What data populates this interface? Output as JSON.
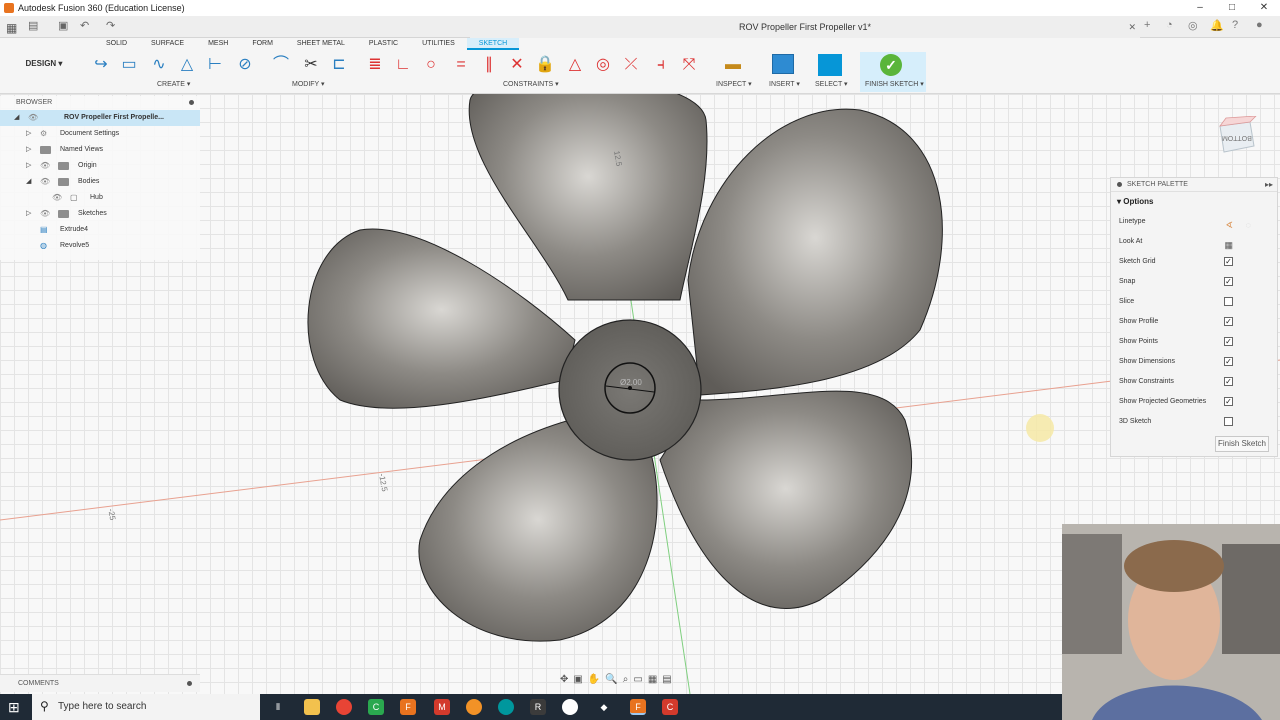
{
  "window": {
    "title": "Autodesk Fusion 360 (Education License)",
    "minimize": "–",
    "maximize": "□",
    "close": "✕"
  },
  "document_tab": {
    "title": "ROV Propeller First Propeller v1*",
    "close": "✕"
  },
  "design_menu": {
    "label": "DESIGN ▾"
  },
  "workspace_tabs": [
    "SOLID",
    "SURFACE",
    "MESH",
    "FORM",
    "SHEET METAL",
    "PLASTIC",
    "UTILITIES",
    "SKETCH"
  ],
  "active_workspace": "SKETCH",
  "toolbar_groups": {
    "create": "CREATE ▾",
    "modify": "MODIFY ▾",
    "constraints": "CONSTRAINTS ▾",
    "inspect": "INSPECT ▾",
    "insert": "INSERT ▾",
    "select": "SELECT ▾",
    "finish_sketch": "FINISH SKETCH ▾"
  },
  "browser": {
    "header": "BROWSER",
    "root": "ROV Propeller First Propelle...",
    "items": [
      {
        "label": "Document Settings",
        "icon": "gear-icon"
      },
      {
        "label": "Named Views",
        "icon": "folder-icon"
      },
      {
        "label": "Origin",
        "icon": "folder-icon"
      },
      {
        "label": "Bodies",
        "icon": "folder-icon"
      },
      {
        "label": "Hub",
        "icon": "body-icon"
      },
      {
        "label": "Sketches",
        "icon": "folder-icon"
      },
      {
        "label": "Extrude4",
        "icon": "extrude-icon"
      },
      {
        "label": "Revolve5",
        "icon": "revolve-icon"
      }
    ]
  },
  "viewport": {
    "dimension_top": "12.5",
    "dimension_left": "-12.5",
    "dimension_far_left": "-25",
    "hub_dimension": "Ø2.00",
    "viewcube_label": "BOTTOM"
  },
  "sketch_palette": {
    "header": "SKETCH PALETTE",
    "section": "Options",
    "rows": [
      {
        "label": "Linetype",
        "type": "linetype"
      },
      {
        "label": "Look At",
        "type": "button"
      },
      {
        "label": "Sketch Grid",
        "type": "checkbox",
        "checked": true
      },
      {
        "label": "Snap",
        "type": "checkbox",
        "checked": true
      },
      {
        "label": "Slice",
        "type": "checkbox",
        "checked": false
      },
      {
        "label": "Show Profile",
        "type": "checkbox",
        "checked": true
      },
      {
        "label": "Show Points",
        "type": "checkbox",
        "checked": true
      },
      {
        "label": "Show Dimensions",
        "type": "checkbox",
        "checked": true
      },
      {
        "label": "Show Constraints",
        "type": "checkbox",
        "checked": true
      },
      {
        "label": "Show Projected Geometries",
        "type": "checkbox",
        "checked": true
      },
      {
        "label": "3D Sketch",
        "type": "checkbox",
        "checked": false
      }
    ],
    "finish_button": "Finish Sketch"
  },
  "comments": {
    "label": "COMMENTS"
  },
  "taskbar": {
    "search_placeholder": "Type here to search"
  },
  "colors": {
    "accent": "#0696d7",
    "finish_green": "#5ab53a",
    "taskbar": "#1f2a36",
    "body_shade": "#6f6d69"
  }
}
